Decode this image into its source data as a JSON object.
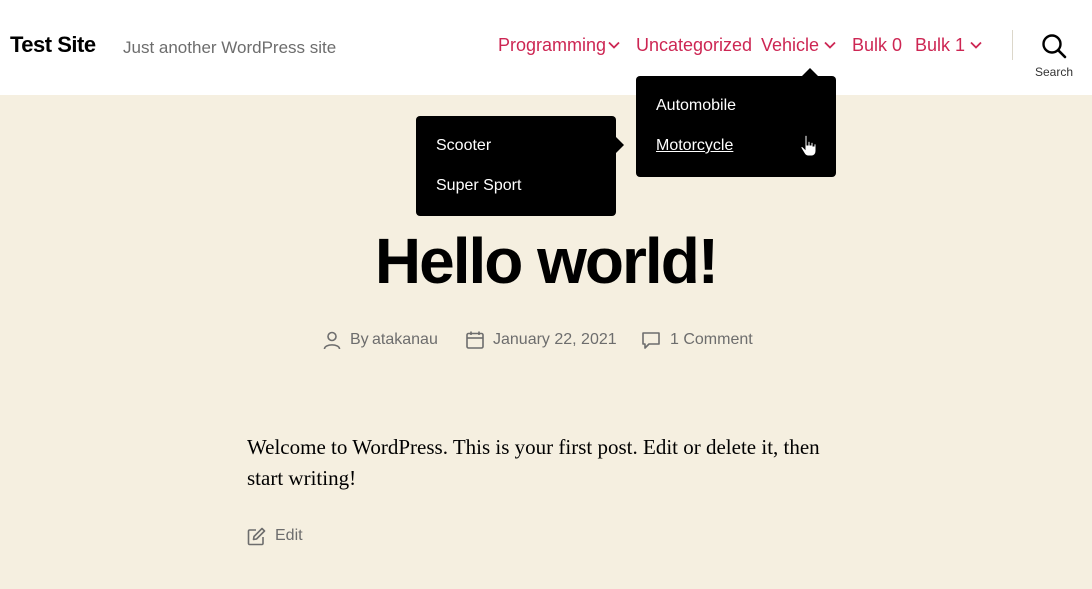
{
  "site": {
    "title": "Test Site",
    "description": "Just another WordPress site"
  },
  "nav": {
    "items": [
      {
        "label": "Programming",
        "has_children": true
      },
      {
        "label": "Uncategorized",
        "has_children": false
      },
      {
        "label": "Vehicle",
        "has_children": true
      },
      {
        "label": "Bulk 0",
        "has_children": false
      },
      {
        "label": "Bulk 1",
        "has_children": true
      }
    ],
    "vehicle_submenu": [
      "Automobile",
      "Motorcycle"
    ],
    "motorcycle_submenu": [
      "Scooter",
      "Super Sport"
    ]
  },
  "search": {
    "label": "Search",
    "icon": "search-icon"
  },
  "post": {
    "title": "Hello world!",
    "author_prefix": "By",
    "author": "atakanau",
    "date": "January 22, 2021",
    "comments": "1 Comment",
    "content": "Welcome to WordPress. This is your first post. Edit or delete it, then start writing!",
    "edit_label": "Edit"
  },
  "colors": {
    "accent": "#cd2653",
    "background": "#f5efe0",
    "header": "#ffffff",
    "dropdown": "#000000",
    "meta_text": "#6d6d6d"
  }
}
